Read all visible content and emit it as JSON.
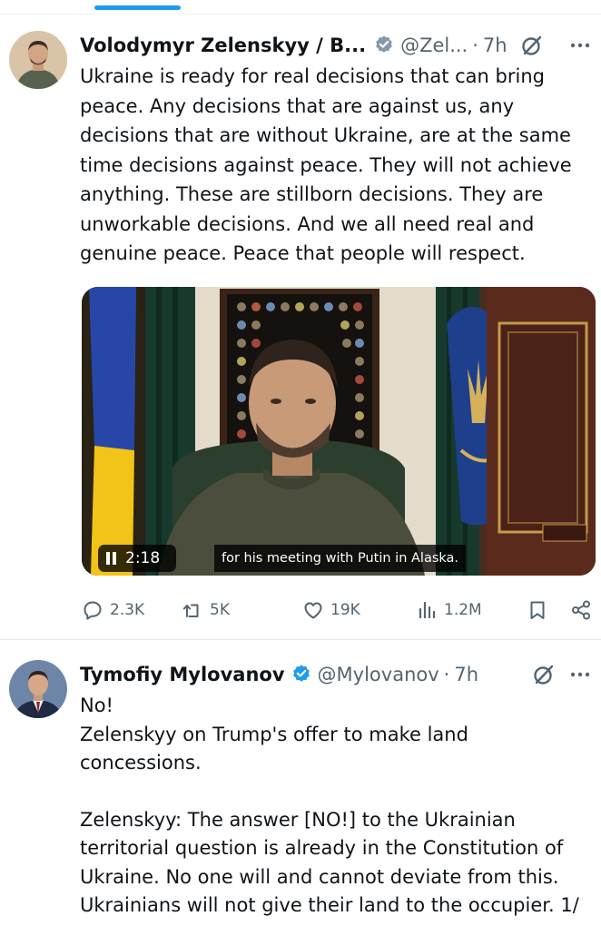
{
  "tweets": [
    {
      "author_name": "Volodymyr Zelenskyy / В...",
      "handle": "@Zel...",
      "separator": "·",
      "time": "7h",
      "text_lines": [
        "Ukraine is ready for real decisions that can bring",
        "peace. Any decisions that are against us, any",
        "decisions that are without Ukraine, are at the same",
        "time decisions against peace. They will not achieve",
        "anything. These are stillborn decisions. They are",
        "unworkable decisions. And we all need real and",
        "genuine peace. Peace that people will respect."
      ],
      "video": {
        "duration": "2:18",
        "caption": "for his meeting with Putin in Alaska."
      },
      "stats": {
        "replies": "2.3K",
        "reposts": "5K",
        "likes": "19K",
        "views": "1.2M"
      }
    },
    {
      "author_name": "Tymofiy Mylovanov",
      "handle": "@Mylovanov",
      "separator": "·",
      "time": "7h",
      "text_lines": [
        "No!",
        "Zelenskyy on Trump's offer to make land",
        "concessions.",
        "",
        "Zelenskyy: The answer [NO!] to the Ukrainian",
        "territorial question is already in the Constitution of",
        "Ukraine. No one will and cannot deviate from this.",
        "Ukrainians will not give their land to the occupier. 1/"
      ]
    }
  ],
  "colors": {
    "accent_blue": "#1d9bf0",
    "text_primary": "#0f1419",
    "text_secondary": "#536471"
  },
  "icons": {
    "verified": "verified-badge-icon",
    "grok": "grok-icon",
    "more": "more-icon",
    "reply": "reply-icon",
    "repost": "repost-icon",
    "like": "heart-icon",
    "views": "views-icon",
    "bookmark": "bookmark-icon",
    "share": "share-icon"
  }
}
